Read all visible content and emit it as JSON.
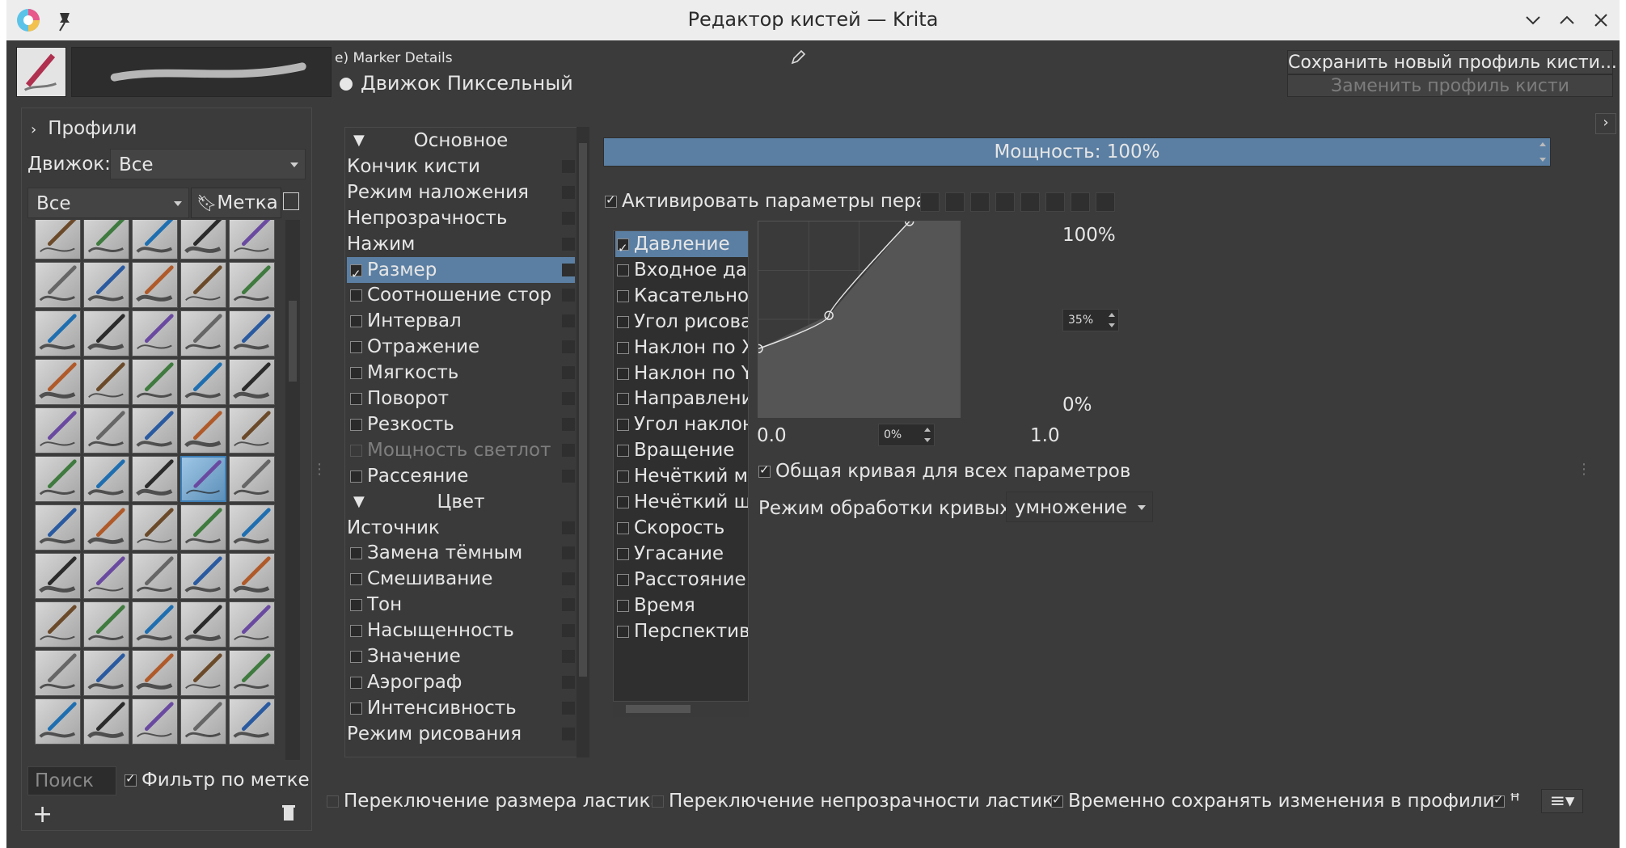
{
  "window": {
    "title": "Редактор кистей — Krita"
  },
  "header": {
    "preset_name": "e) Marker Details",
    "engine_label": "Движок Пиксельный",
    "save_new_label": "Сохранить новый профиль кисти...",
    "overwrite_label": "Заменить профиль кисти"
  },
  "presets_panel": {
    "title": "Профили",
    "engine_label": "Движок:",
    "engine_value": "Все",
    "tag_filter_value": "Все",
    "tag_button": "Метка",
    "search_placeholder": "Поиск",
    "filter_by_tag": "Фильтр по метке",
    "rows": 11,
    "columns": 5,
    "selected_index": 28
  },
  "options": [
    {
      "label": "Основное",
      "type": "header"
    },
    {
      "label": "Кончик кисти",
      "type": "plain"
    },
    {
      "label": "Режим наложения",
      "type": "plain"
    },
    {
      "label": "Непрозрачность",
      "type": "plain"
    },
    {
      "label": "Нажим",
      "type": "plain"
    },
    {
      "label": "Размер",
      "type": "check",
      "checked": true,
      "selected": true
    },
    {
      "label": "Соотношение стор",
      "type": "check",
      "checked": false
    },
    {
      "label": "Интервал",
      "type": "check",
      "checked": false
    },
    {
      "label": "Отражение",
      "type": "check",
      "checked": false
    },
    {
      "label": "Мягкость",
      "type": "check",
      "checked": false
    },
    {
      "label": "Поворот",
      "type": "check",
      "checked": false
    },
    {
      "label": "Резкость",
      "type": "check",
      "checked": false
    },
    {
      "label": "Мощность светлот",
      "type": "check",
      "checked": false,
      "disabled": true
    },
    {
      "label": "Рассеяние",
      "type": "check",
      "checked": false
    },
    {
      "label": "Цвет",
      "type": "header"
    },
    {
      "label": "Источник",
      "type": "plain"
    },
    {
      "label": "Замена тёмным",
      "type": "check",
      "checked": false
    },
    {
      "label": "Смешивание",
      "type": "check",
      "checked": false
    },
    {
      "label": "Тон",
      "type": "check",
      "checked": false
    },
    {
      "label": "Насыщенность",
      "type": "check",
      "checked": false
    },
    {
      "label": "Значение",
      "type": "check",
      "checked": false
    },
    {
      "label": "Аэрограф",
      "type": "check",
      "checked": false
    },
    {
      "label": "Интенсивность",
      "type": "check",
      "checked": false
    },
    {
      "label": "Режим рисования",
      "type": "plain"
    }
  ],
  "strength": {
    "label": "Мощность: 100%"
  },
  "pen_settings": {
    "label": "Активировать параметры пера",
    "checked": true
  },
  "sensors": [
    {
      "label": "Давление",
      "checked": true,
      "selected": true
    },
    {
      "label": "Входное дав",
      "checked": false
    },
    {
      "label": "Касательное",
      "checked": false
    },
    {
      "label": "Угол рисова",
      "checked": false
    },
    {
      "label": "Наклон по X",
      "checked": false
    },
    {
      "label": "Наклон по Y",
      "checked": false
    },
    {
      "label": "Направлени",
      "checked": false
    },
    {
      "label": "Угол наклон",
      "checked": false
    },
    {
      "label": "Вращение",
      "checked": false
    },
    {
      "label": "Нечёткий ма",
      "checked": false
    },
    {
      "label": "Нечёткий шт",
      "checked": false
    },
    {
      "label": "Скорость",
      "checked": false
    },
    {
      "label": "Угасание",
      "checked": false
    },
    {
      "label": "Расстояние",
      "checked": false
    },
    {
      "label": "Время",
      "checked": false
    },
    {
      "label": "Перспектива",
      "checked": false
    }
  ],
  "curve": {
    "y_max": "100%",
    "y_min": "0%",
    "y_spin": "35%",
    "x_min": "0.0",
    "x_max": "1.0",
    "x_spin": "0%",
    "points": [
      [
        0,
        0.35
      ],
      [
        0.35,
        0.52
      ],
      [
        0.75,
        1.0
      ]
    ],
    "shared_curve_label": "Общая кривая для всех параметров",
    "mode_label": "Режим обработки кривых:",
    "mode_value": "умножение"
  },
  "footer": {
    "eraser_size": "Переключение размера ластика",
    "eraser_opacity": "Переключение непрозрачности ластика",
    "temp_save": "Временно сохранять изменения в профили"
  },
  "colors": {
    "selection": "#5b7fa3",
    "bg": "#3b3b3b",
    "titlebar": "#ededed"
  }
}
